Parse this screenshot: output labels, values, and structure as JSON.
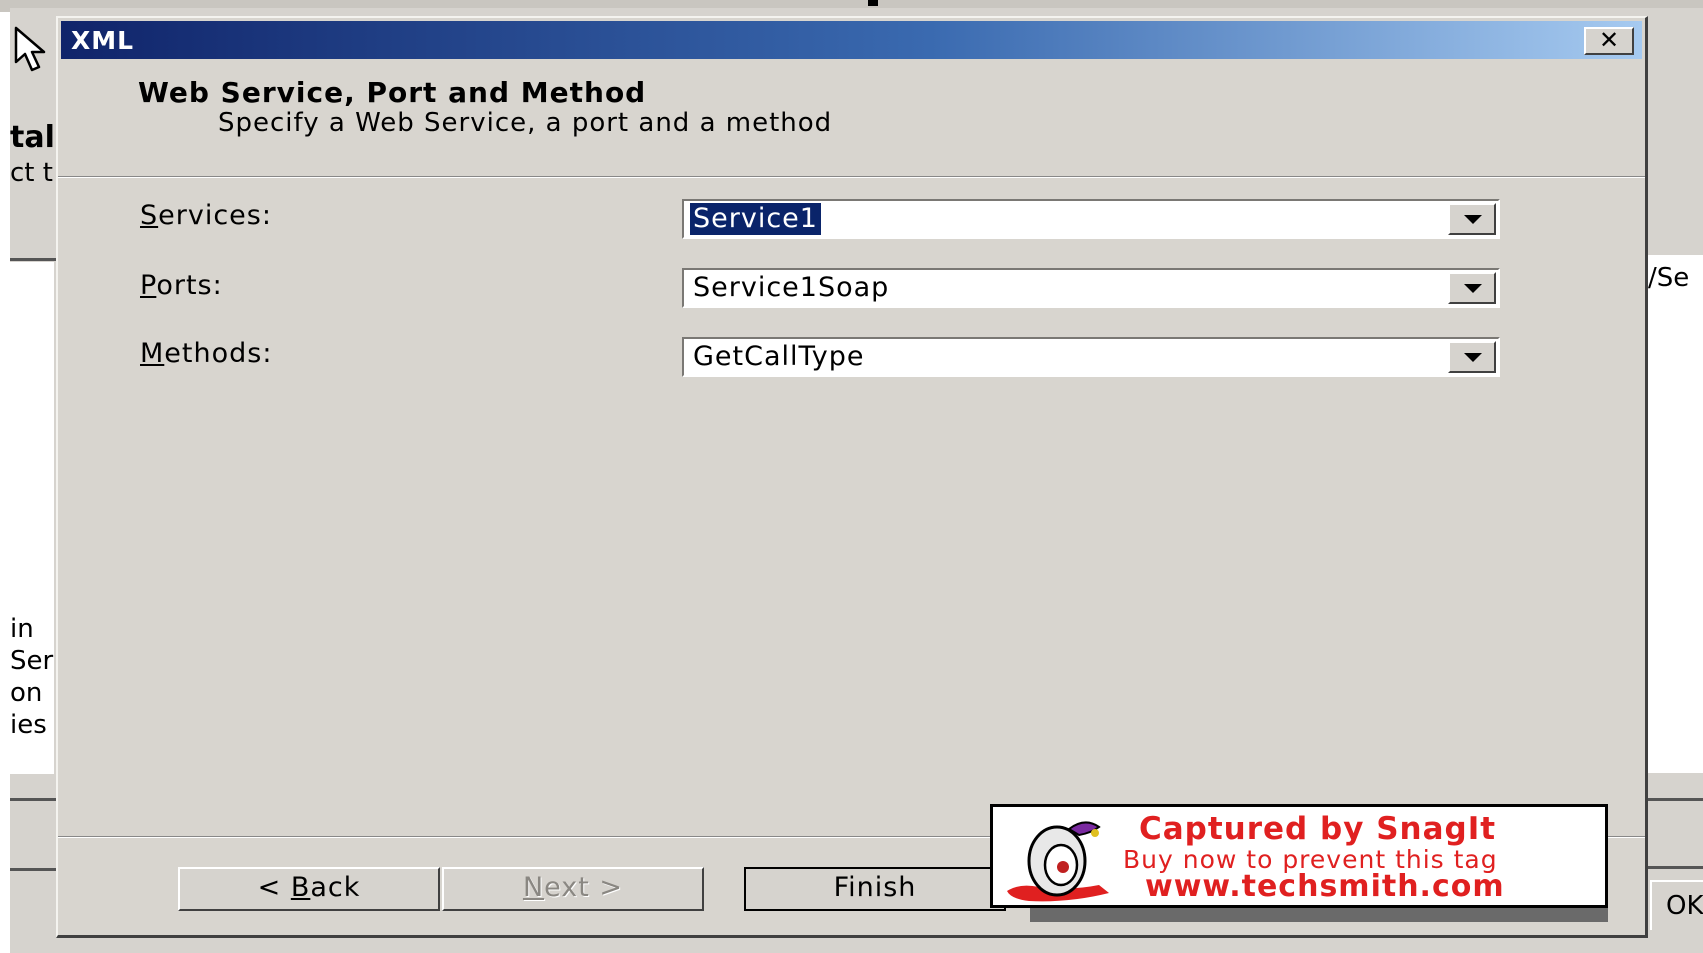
{
  "background": {
    "left_fragments": [
      "tal",
      "ct t"
    ],
    "left_lower_fragments": [
      "in",
      "Ser",
      "on",
      "ies"
    ],
    "right_fragment": "/Se",
    "ok_button": "OK"
  },
  "dialog": {
    "title": "XML",
    "close_glyph": "✕",
    "header_title": "Web Service, Port and Method",
    "header_subtitle": "Specify a Web Service, a port and a method"
  },
  "fields": {
    "services": {
      "label_accel": "S",
      "label_rest": "ervices:",
      "value": "Service1"
    },
    "ports": {
      "label_accel": "P",
      "label_rest": "orts:",
      "value": "Service1Soap"
    },
    "methods": {
      "label_accel": "M",
      "label_rest": "ethods:",
      "value": "GetCallType"
    }
  },
  "buttons": {
    "back_prefix": "< ",
    "back_accel": "B",
    "back_rest": "ack",
    "next_accel": "N",
    "next_rest": "ext >",
    "finish": "Finish"
  },
  "snagit": {
    "line1": "Captured by SnagIt",
    "line2": "Buy now to prevent this tag",
    "line3": "www.techsmith.com"
  },
  "colors": {
    "titlebar_start": "#10246a",
    "titlebar_end": "#a6caf0",
    "selection": "#0a246a",
    "snagit_red": "#e02020"
  }
}
